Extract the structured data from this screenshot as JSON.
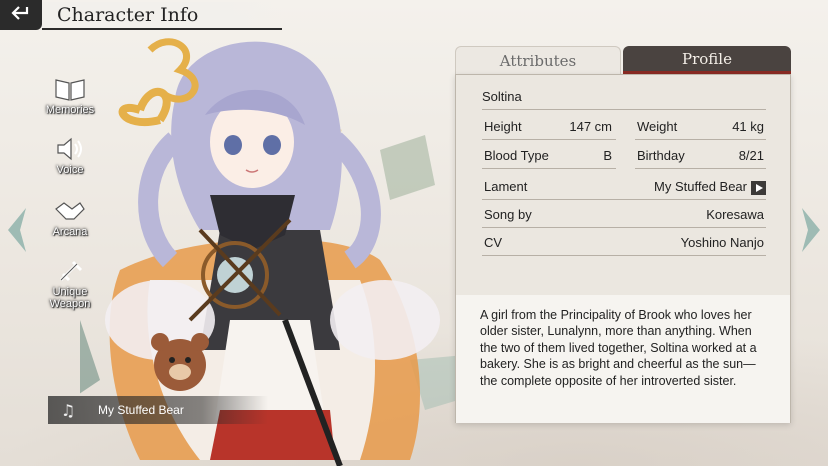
{
  "header": {
    "title": "Character Info"
  },
  "side_menu": {
    "items": [
      {
        "label": "Memories",
        "icon": "book-icon"
      },
      {
        "label": "Voice",
        "icon": "speaker-icon"
      },
      {
        "label": "Arcana",
        "icon": "handshake-icon"
      },
      {
        "label": "Unique\nWeapon",
        "icon": "weapon-icon"
      }
    ]
  },
  "song_bar": {
    "title": "My Stuffed Bear",
    "icon": "music-note-icon"
  },
  "panel": {
    "tabs": [
      {
        "label": "Attributes",
        "active": false
      },
      {
        "label": "Profile",
        "active": true
      }
    ],
    "profile": {
      "name": "Soltina",
      "height_label": "Height",
      "height_value": "147 cm",
      "weight_label": "Weight",
      "weight_value": "41 kg",
      "blood_label": "Blood Type",
      "blood_value": "B",
      "birthday_label": "Birthday",
      "birthday_value": "8/21",
      "lament_label": "Lament",
      "lament_value": "My Stuffed Bear",
      "song_label": "Song by",
      "song_value": "Koresawa",
      "cv_label": "CV",
      "cv_value": "Yoshino Nanjo",
      "description": "A girl from the Principality of Brook who loves her older sister, Lunalynn, more than anything. When the two of them lived together, Soltina worked at a bakery. She is as bright and cheerful as the sun—the complete opposite of her introverted sister."
    }
  },
  "colors": {
    "active_tab": "#4a4340",
    "tab_accent": "#8a2b24",
    "card_bg": "#ebe7e0",
    "hair": "#b9b7d8",
    "cloak": "#e89a4a"
  }
}
